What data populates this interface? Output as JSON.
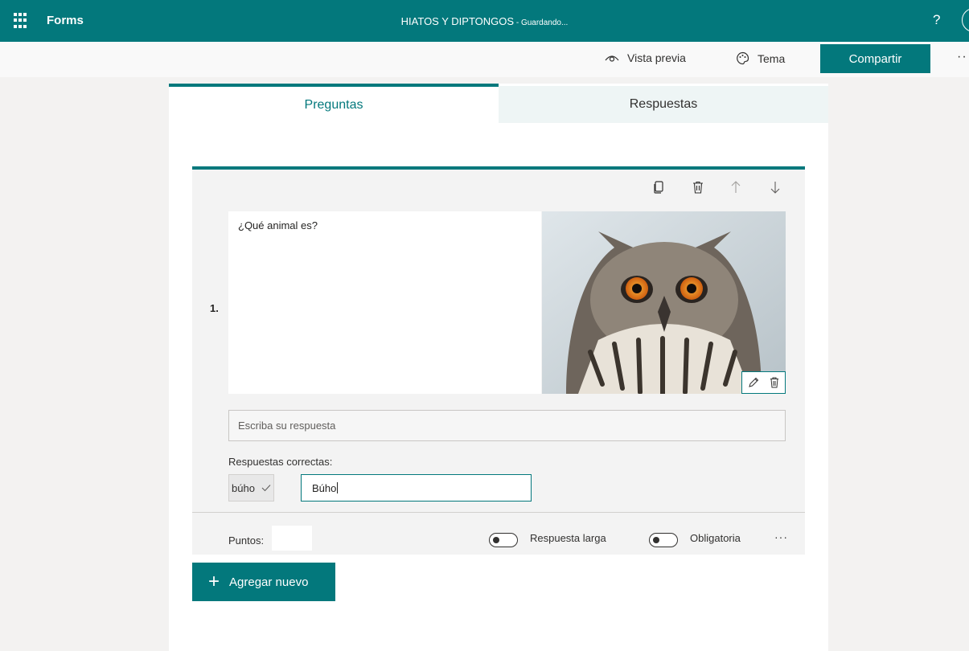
{
  "topbar": {
    "app_name": "Forms",
    "form_title": "HIATOS Y DIPTONGOS",
    "separator": " - ",
    "save_status": "Guardando...",
    "help": "?"
  },
  "commandbar": {
    "preview_label": "Vista previa",
    "theme_label": "Tema",
    "share_label": "Compartir",
    "more": "··"
  },
  "tabs": {
    "questions": "Preguntas",
    "responses": "Respuestas"
  },
  "question": {
    "number": "1.",
    "text": "¿Qué animal es?",
    "image_icon": "owl-photo",
    "answer_placeholder": "Escriba su respuesta",
    "correct_answers_label": "Respuestas correctas:",
    "correct_answers": [
      "búho"
    ],
    "new_answer_value": "Búho",
    "points_label": "Puntos:",
    "points_value": "",
    "long_answer_label": "Respuesta larga",
    "long_answer_on": false,
    "required_label": "Obligatoria",
    "required_on": false,
    "more": "···"
  },
  "add_new_label": "Agregar nuevo",
  "colors": {
    "accent": "#03787c",
    "background": "#f3f2f1",
    "card": "#f3f3f3"
  }
}
